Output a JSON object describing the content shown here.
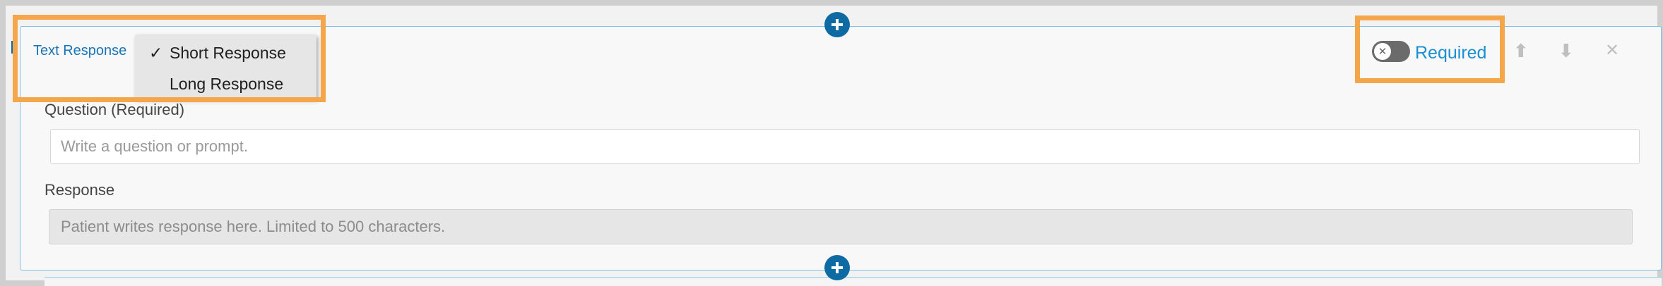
{
  "card": {
    "type_label": "Text Response",
    "response_type_menu": {
      "options": [
        {
          "label": "Short Response",
          "selected": true,
          "check": "✓"
        },
        {
          "label": "Long Response",
          "selected": false,
          "check": ""
        }
      ]
    },
    "required_toggle": {
      "label": "Required",
      "on": false,
      "knob_glyph": "✕"
    },
    "controls": {
      "move_up_glyph": "⬆",
      "move_down_glyph": "⬇",
      "delete_glyph": "✕"
    },
    "question": {
      "label": "Question (Required)",
      "placeholder": "Write a question or prompt.",
      "value": ""
    },
    "response": {
      "label": "Response",
      "placeholder": "Patient writes response here. Limited to 500 characters."
    }
  },
  "colors": {
    "accent_blue": "#0d6aa3",
    "link_blue": "#1a8fd1",
    "highlight_orange": "#f5a54a",
    "card_border": "#7fc1e6"
  },
  "icons": {
    "add_button": "plus-icon",
    "toggle_knob": "close-icon",
    "move_up": "arrow-up-icon",
    "move_down": "arrow-down-icon",
    "delete": "close-icon"
  }
}
